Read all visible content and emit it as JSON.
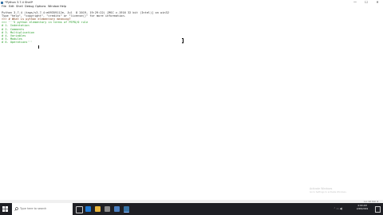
{
  "window": {
    "title": "*Python 3.7.4 Shell*",
    "controls": {
      "minimize": "—",
      "maximize": "☐",
      "close": "✕"
    }
  },
  "menu": [
    "File",
    "Edit",
    "Shell",
    "Debug",
    "Options",
    "Window",
    "Help"
  ],
  "shell": {
    "lines": [
      {
        "text": "Python 3.7.4 (tags/v3.7.4:e09359112e, Jul  8 2019, 19:29:22) [MSC v.1916 32 bit (Intel)] on win32",
        "style": "dark"
      },
      {
        "text": "Type \"help\", \"copyright\", \"credits\" or \"license()\" for more information.",
        "style": "dark"
      },
      {
        "text": ">>> # What is python elementary meaning?",
        "style": "prompt"
      },
      {
        "text": ">>> '''5 python elementary in terms of PEP8/0 rule",
        "style": "green"
      },
      {
        "text": "# 1. Indentation",
        "style": "green"
      },
      {
        "text": "# 2. Comments",
        "style": "green"
      },
      {
        "text": "# 3. Multiplication",
        "style": "green"
      },
      {
        "text": "# 4. Variables",
        "style": "green"
      },
      {
        "text": "# 5. Modules",
        "style": "green"
      },
      {
        "text": "# 6. Operations'''",
        "style": "green"
      }
    ]
  },
  "status": {
    "position": "Ln: 12  Col: 4"
  },
  "watermark": [
    "Activate Windows",
    "Go to Settings to activate Windows."
  ],
  "taskbar": {
    "search_placeholder": "Type here to search",
    "clock_time": "4:00 AM",
    "clock_date": "2/28/2019"
  },
  "colors": {
    "green_text": "#2ea02e",
    "prompt_text": "#7a3a12",
    "taskbar_bg": "#1e1f24"
  }
}
